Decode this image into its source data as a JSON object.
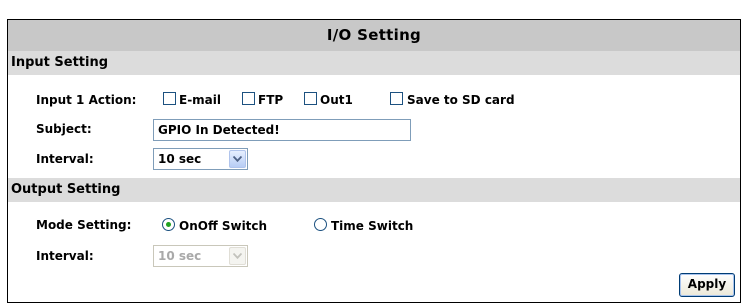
{
  "title": "I/O Setting",
  "input_section": {
    "header": "Input Setting",
    "action_label": "Input 1 Action:",
    "actions": [
      {
        "label": "E-mail",
        "checked": false
      },
      {
        "label": "FTP",
        "checked": false
      },
      {
        "label": "Out1",
        "checked": false
      },
      {
        "label": "Save to SD card",
        "checked": false
      }
    ],
    "subject_label": "Subject:",
    "subject_value": "GPIO In Detected!",
    "interval_label": "Interval:",
    "interval_value": "10 sec"
  },
  "output_section": {
    "header": "Output Setting",
    "mode_label": "Mode Setting:",
    "modes": [
      {
        "label": "OnOff Switch",
        "selected": true
      },
      {
        "label": "Time Switch",
        "selected": false
      }
    ],
    "interval_label": "Interval:",
    "interval_value": "10 sec",
    "interval_disabled": true
  },
  "apply_label": "Apply",
  "colors": {
    "title_bar": "#c8c8c8",
    "section_bar": "#dcdcdc",
    "radio_selected": "#21a121",
    "checkbox_border": "#1c5180"
  }
}
